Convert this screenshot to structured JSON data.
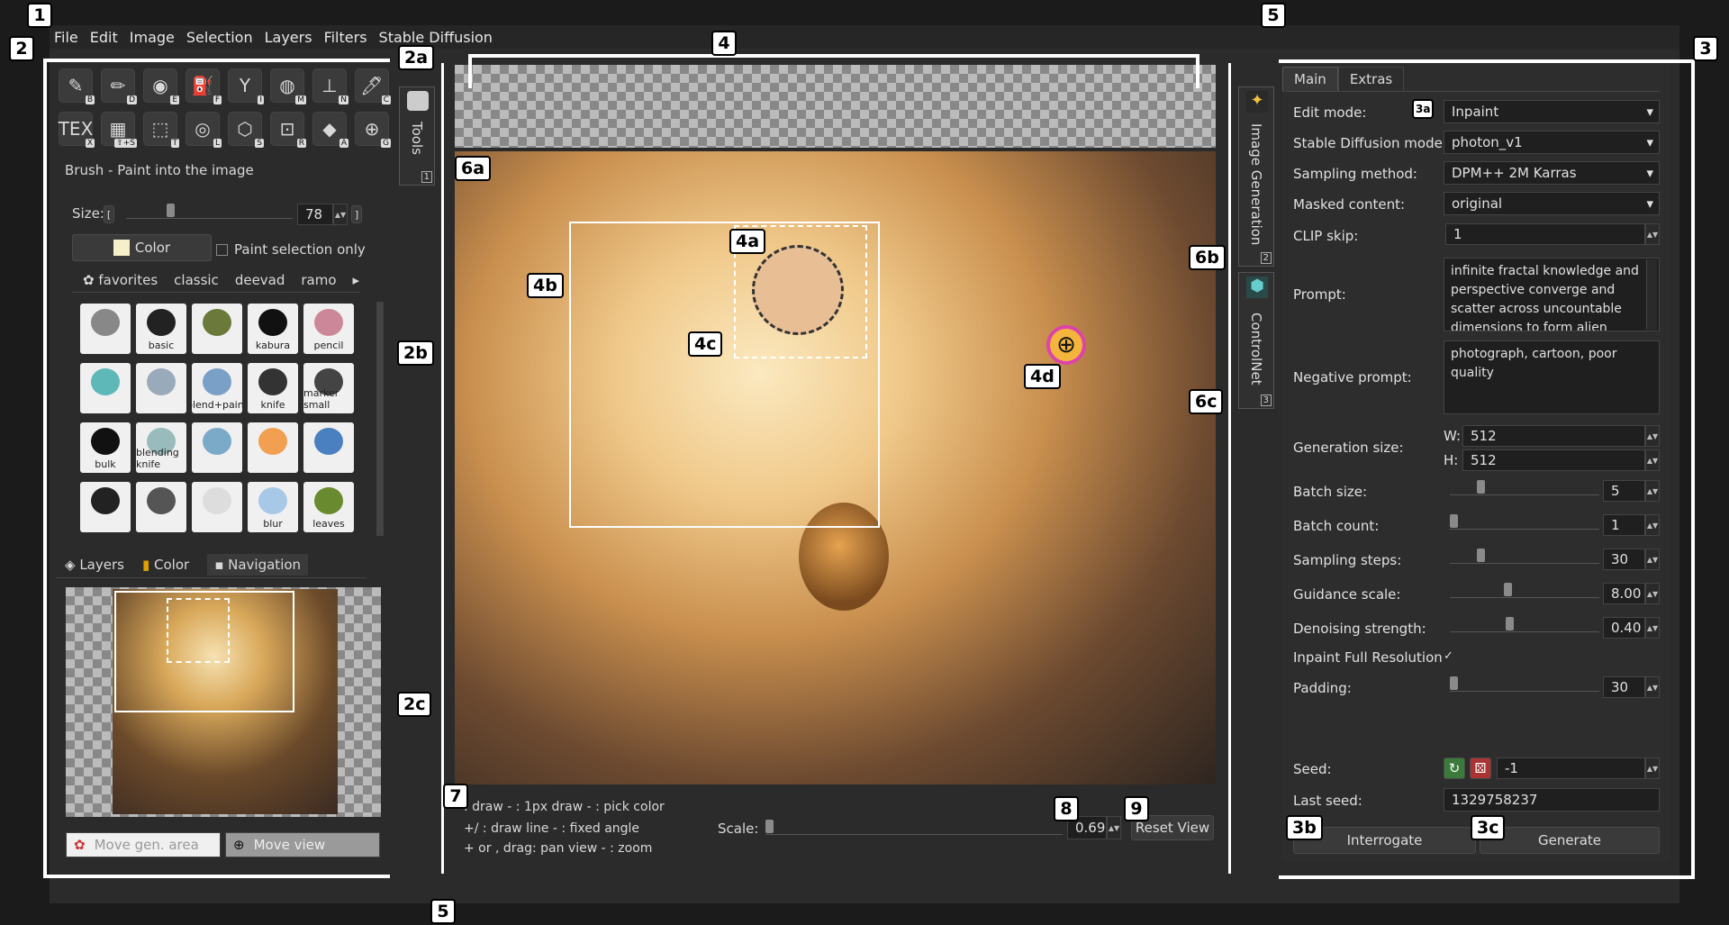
{
  "menu": [
    "File",
    "Edit",
    "Image",
    "Selection",
    "Layers",
    "Filters",
    "Stable Diffusion"
  ],
  "badges": {
    "b1": "1",
    "b2": "2",
    "b2a": "2a",
    "b2b": "2b",
    "b2c": "2c",
    "b3": "3",
    "b3a": "3a",
    "b3b": "3b",
    "b3c": "3c",
    "b4": "4",
    "b4a": "4a",
    "b4b": "4b",
    "b4c": "4c",
    "b4d": "4d",
    "b5a": "5",
    "b5b": "5",
    "b6a": "6a",
    "b6b": "6b",
    "b6c": "6c",
    "b7": "7",
    "b8": "8",
    "b9": "9"
  },
  "tools": {
    "row1": [
      {
        "icon": "✎",
        "key": "B"
      },
      {
        "icon": "✏",
        "key": "D"
      },
      {
        "icon": "◉",
        "key": "E"
      },
      {
        "icon": "⛽",
        "key": "F"
      },
      {
        "icon": "Y",
        "key": "I"
      },
      {
        "icon": "◍",
        "key": "M"
      },
      {
        "icon": "⊥",
        "key": "N"
      },
      {
        "icon": "🖊",
        "key": "C"
      }
    ],
    "row2": [
      {
        "icon": "TEX",
        "key": "X"
      },
      {
        "icon": "▦",
        "key": "⇧+S"
      },
      {
        "icon": "⬚",
        "key": "T"
      },
      {
        "icon": "◎",
        "key": "L"
      },
      {
        "icon": "⬡",
        "key": "S"
      },
      {
        "icon": "⊡",
        "key": "R"
      },
      {
        "icon": "◆",
        "key": "A"
      },
      {
        "icon": "⊕",
        "key": "G"
      }
    ]
  },
  "tools_tab": {
    "label": "Tools",
    "num": "1"
  },
  "brush": {
    "title": "Brush - Paint into the image",
    "size_label": "Size:",
    "size_value": "78",
    "size_left": "[",
    "size_right": "]",
    "color_label": "Color",
    "paint_sel": "Paint selection only",
    "tabs": [
      "favorites",
      "classic",
      "deevad",
      "ramo"
    ]
  },
  "brushes": [
    "",
    "basic",
    "",
    "kabura",
    "pencil",
    "",
    "",
    "blend+paint",
    "knife",
    "marker small",
    "bulk",
    "blending knife",
    "",
    "",
    "",
    "",
    "",
    "",
    "blur",
    "leaves"
  ],
  "dock_tabs": [
    "Layers",
    "Color",
    "Navigation"
  ],
  "nav": {
    "move_gen": "Move gen. area",
    "move_view": "Move view"
  },
  "hints": {
    "line1": ": draw - : 1px draw - : pick color",
    "line2": "+/ : draw line - : fixed angle",
    "line3": "+ or , drag: pan view - : zoom"
  },
  "scale": {
    "label": "Scale:",
    "value": "0.69",
    "reset": "Reset View",
    "fill": 0.3
  },
  "side_tabs": [
    {
      "label": "Image Generation",
      "num": "2"
    },
    {
      "label": "ControlNet",
      "num": "3"
    }
  ],
  "right": {
    "tabs": [
      "Main",
      "Extras"
    ],
    "edit_mode_label": "Edit mode:",
    "edit_mode": "Inpaint",
    "model_label": "Stable Diffusion model:",
    "model": "photon_v1",
    "sampler_label": "Sampling method:",
    "sampler": "DPM++ 2M Karras",
    "masked_label": "Masked content:",
    "masked": "original",
    "clip_label": "CLIP skip:",
    "clip": "1",
    "prompt_label": "Prompt:",
    "prompt": "infinite fractal knowledge and perspective converge and scatter across uncountable dimensions to form alien",
    "neg_label": "Negative prompt:",
    "neg": "photograph, cartoon, poor quality",
    "gen_size_label": "Generation size:",
    "w_label": "W:",
    "w": "512",
    "h_label": "H:",
    "h": "512",
    "batch_size_label": "Batch size:",
    "batch_size": "5",
    "batch_count_label": "Batch count:",
    "batch_count": "1",
    "steps_label": "Sampling steps:",
    "steps": "30",
    "guidance_label": "Guidance scale:",
    "guidance": "8.00",
    "denoise_label": "Denoising strength:",
    "denoise": "0.40",
    "inpaint_full_label": "Inpaint Full Resolution",
    "inpaint_full": "✓",
    "padding_label": "Padding:",
    "padding": "30",
    "seed_label": "Seed:",
    "seed": "-1",
    "last_seed_label": "Last seed:",
    "last_seed": "1329758237",
    "interrogate": "Interrogate",
    "generate": "Generate"
  },
  "colors": {
    "accent": "#4a6fa5",
    "bg": "#2b2b2b"
  }
}
